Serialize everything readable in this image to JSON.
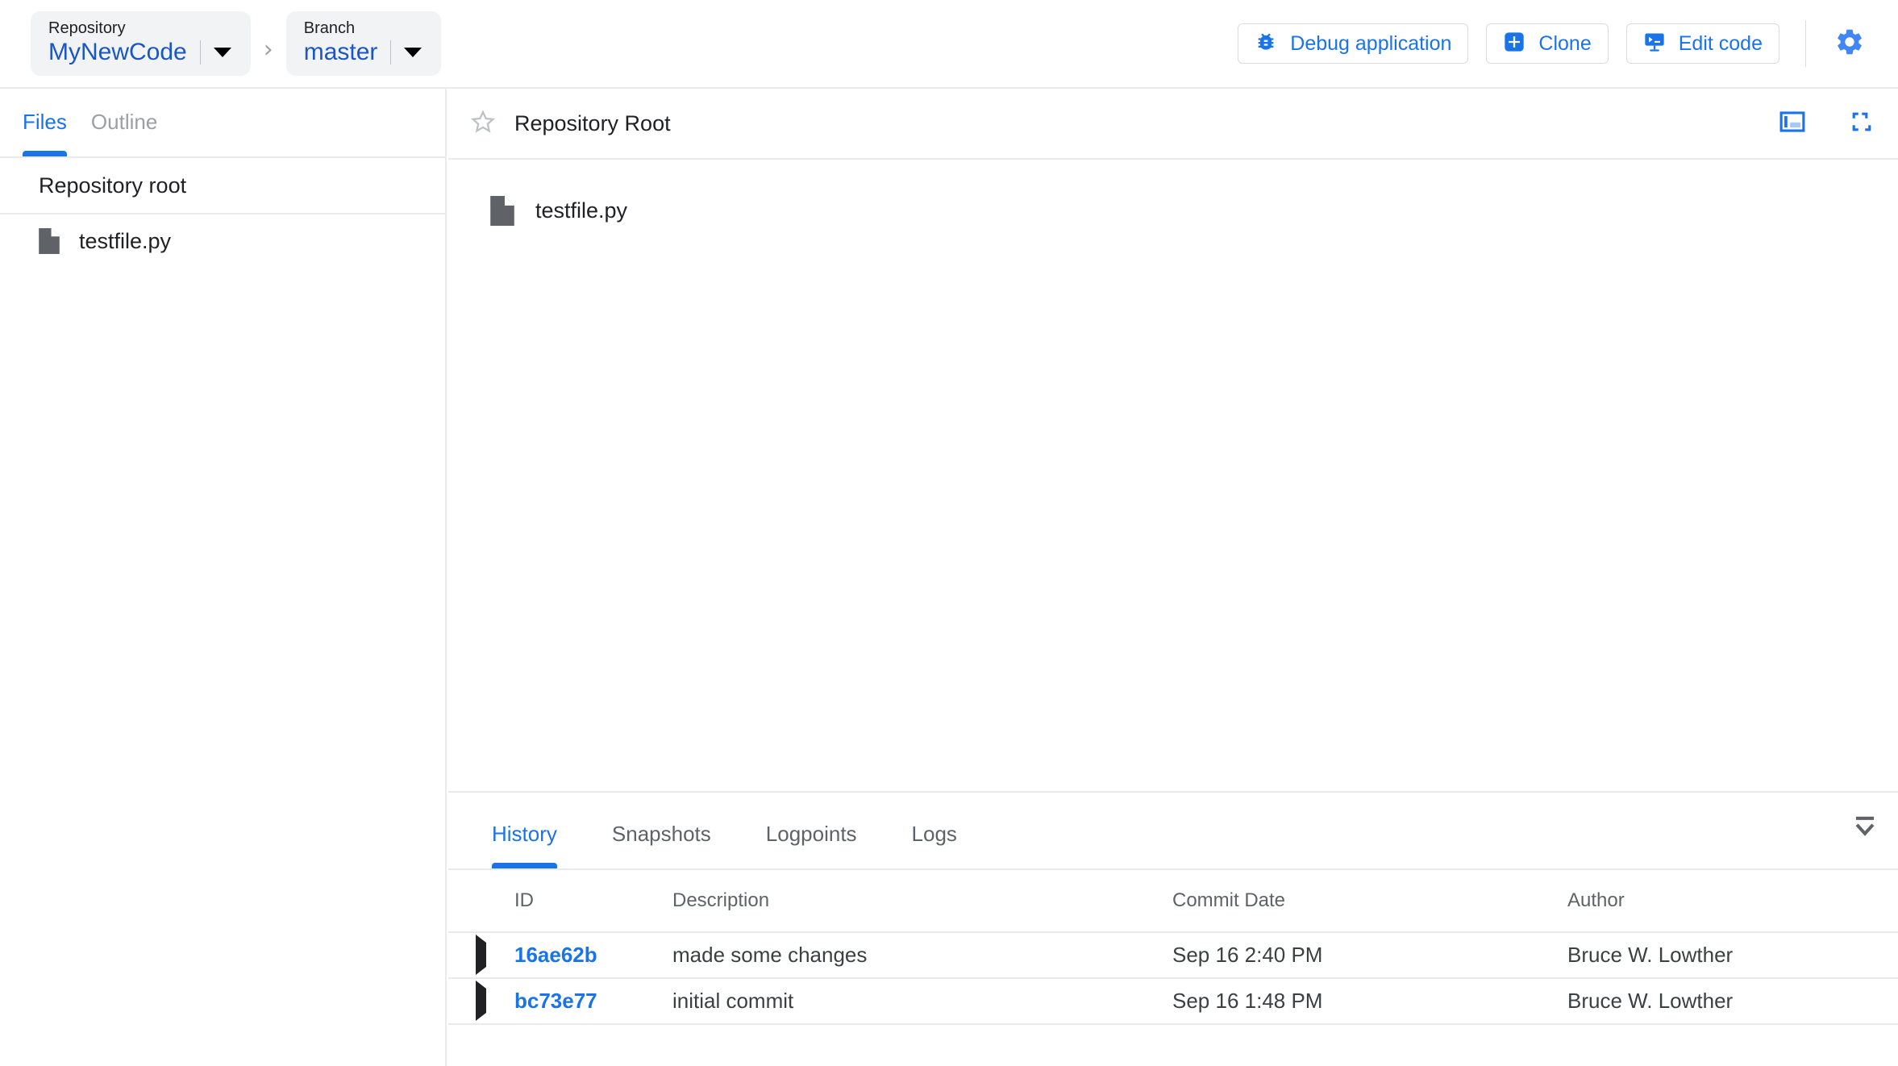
{
  "topbar": {
    "repository": {
      "label": "Repository",
      "value": "MyNewCode",
      "caret_icon": "chevron-down-icon"
    },
    "separator_glyph": "›",
    "branch": {
      "label": "Branch",
      "value": "master",
      "caret_icon": "chevron-down-icon"
    },
    "actions": [
      {
        "label": "Debug application",
        "icon": "bug-icon"
      },
      {
        "label": "Clone",
        "icon": "plus-square-icon"
      },
      {
        "label": "Edit code",
        "icon": "terminal-icon"
      }
    ],
    "settings_icon": "gear-icon",
    "accent_color": "#1a73e8",
    "chip_bg": "#f1f3f4"
  },
  "sidebar": {
    "tabs": [
      {
        "label": "Files",
        "active": true
      },
      {
        "label": "Outline",
        "active": false
      }
    ],
    "root_label": "Repository root",
    "files": [
      {
        "name": "testfile.py",
        "icon": "file-icon"
      }
    ]
  },
  "main": {
    "star_icon": "star-outline-icon",
    "title": "Repository Root",
    "header_icons": [
      {
        "name": "split-panel-icon"
      },
      {
        "name": "fullscreen-icon"
      }
    ],
    "files": [
      {
        "name": "testfile.py",
        "icon": "file-icon"
      }
    ]
  },
  "bottom": {
    "tabs": [
      {
        "label": "History",
        "active": true
      },
      {
        "label": "Snapshots",
        "active": false
      },
      {
        "label": "Logpoints",
        "active": false
      },
      {
        "label": "Logs",
        "active": false
      }
    ],
    "collapse_icon": "collapse-panel-icon",
    "table": {
      "columns": [
        "",
        "ID",
        "Description",
        "Commit Date",
        "Author"
      ],
      "rows": [
        {
          "expand_icon": "triangle-right-icon",
          "id": "16ae62b",
          "description": "made some changes",
          "commit_date": "Sep 16 2:40 PM",
          "author": "Bruce W. Lowther"
        },
        {
          "expand_icon": "triangle-right-icon",
          "id": "bc73e77",
          "description": "initial commit",
          "commit_date": "Sep 16 1:48 PM",
          "author": "Bruce W. Lowther"
        }
      ]
    }
  }
}
